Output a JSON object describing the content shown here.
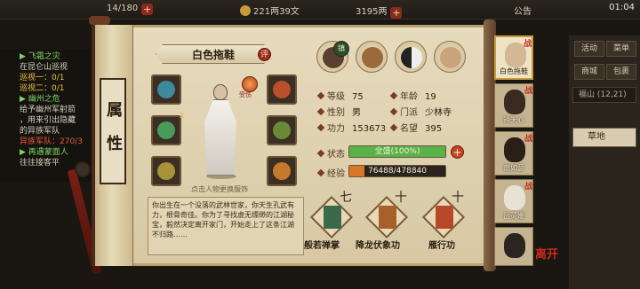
{
  "top_bar": {
    "left_value": "14/180",
    "middle_value": "221两39文",
    "right_value": "3195两",
    "announce": "公告",
    "time": "01:04"
  },
  "quests": {
    "q1_title": "▶ 飞霜之灾",
    "q1_l1": "在昆仑山巡视",
    "q1_l2": "巡视一：0/1",
    "q1_l3": "巡视二：0/1",
    "q2_title": "▶ 幽州之危",
    "q2_l1": "给予幽州军射箭",
    "q2_l2": "，用来引出隐藏",
    "q2_l3": "的异族军队",
    "q2_l4": "异族军队：270/3",
    "q3_title": "▶ 再遇蒙面人",
    "q3_l1": "往往接客平"
  },
  "right_panel": {
    "btn_activity": "活动",
    "btn_menu": "菜单",
    "btn_shop": "商城",
    "btn_pack": "包裹",
    "map_name": "福山",
    "map_coord": "(12,21)",
    "list_item": "草地"
  },
  "scroll_label": "属性",
  "character": {
    "name": "白色拖鞋",
    "badge": "评",
    "fire_label": "受伤",
    "hint": "点击人物更换服饰"
  },
  "top_icons": {
    "ring_label": "镇"
  },
  "equip": {
    "slot_lvl": "1"
  },
  "stats": {
    "level_label": "等级",
    "level": "75",
    "age_label": "年龄",
    "age": "19",
    "gender_label": "性别",
    "gender": "男",
    "sect_label": "门派",
    "sect": "少林寺",
    "power_label": "功力",
    "power": "153673",
    "fame_label": "名望",
    "fame": "395",
    "status_label": "状态",
    "status_text": "全盛(100%)",
    "status_pct": 100,
    "exp_label": "经验",
    "exp_text": "76488/478840",
    "exp_pct": 16
  },
  "bio": "你出生在一个没落的武林世家，你天生孔武有力，根骨奇佳。你为了寻找虚无缥缈的江湖秘宝，毅然决定离开家门，开始走上了这条江湖不归路……",
  "skills": [
    {
      "name": "般若禅掌",
      "cross": "七"
    },
    {
      "name": "降龙伏象功",
      "cross": "十"
    },
    {
      "name": "雁行功",
      "cross": "十"
    }
  ],
  "team": [
    {
      "name": "白色拖鞋",
      "tag": "战"
    },
    {
      "name": "钟天心",
      "tag": "战"
    },
    {
      "name": "南如意",
      "tag": "战"
    },
    {
      "name": "岳灵姗",
      "tag": "战"
    },
    {
      "name": "",
      "tag": ""
    }
  ],
  "leave_label": "离开",
  "colors": {
    "status_bar": "#57b24a",
    "exp_bar": "#d8782a",
    "accent_red": "#c92a1a"
  }
}
